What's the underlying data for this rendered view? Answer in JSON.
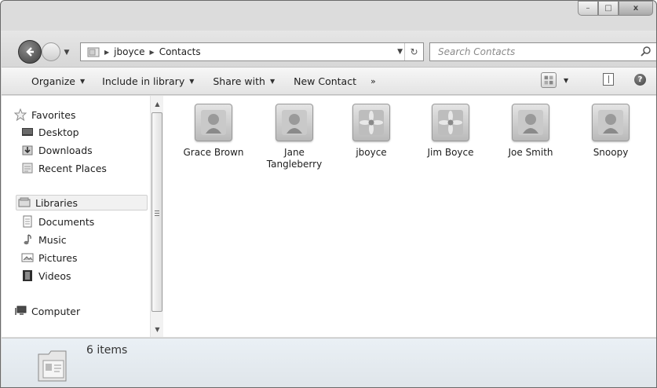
{
  "window": {
    "caption": {
      "minimize": "–",
      "maximize": "□",
      "close": "x"
    }
  },
  "navigation": {
    "breadcrumb": [
      "jboyce",
      "Contacts"
    ],
    "search_placeholder": "Search Contacts"
  },
  "commandbar": {
    "organize": "Organize",
    "include": "Include in library",
    "share": "Share with",
    "new_contact": "New Contact",
    "more": "»"
  },
  "navpane": {
    "favorites": {
      "label": "Favorites",
      "items": [
        "Desktop",
        "Downloads",
        "Recent Places"
      ]
    },
    "libraries": {
      "label": "Libraries",
      "items": [
        "Documents",
        "Music",
        "Pictures",
        "Videos"
      ]
    },
    "computer": "Computer"
  },
  "contacts": [
    {
      "name": "Grace Brown",
      "avatar": "person-icon"
    },
    {
      "name": "Jane Tangleberry",
      "avatar": "person-icon"
    },
    {
      "name": "jboyce",
      "avatar": "flower-icon"
    },
    {
      "name": "Jim Boyce",
      "avatar": "flower-icon"
    },
    {
      "name": "Joe Smith",
      "avatar": "person-icon"
    },
    {
      "name": "Snoopy",
      "avatar": "person-icon"
    }
  ],
  "details": {
    "item_count": "6 items"
  }
}
